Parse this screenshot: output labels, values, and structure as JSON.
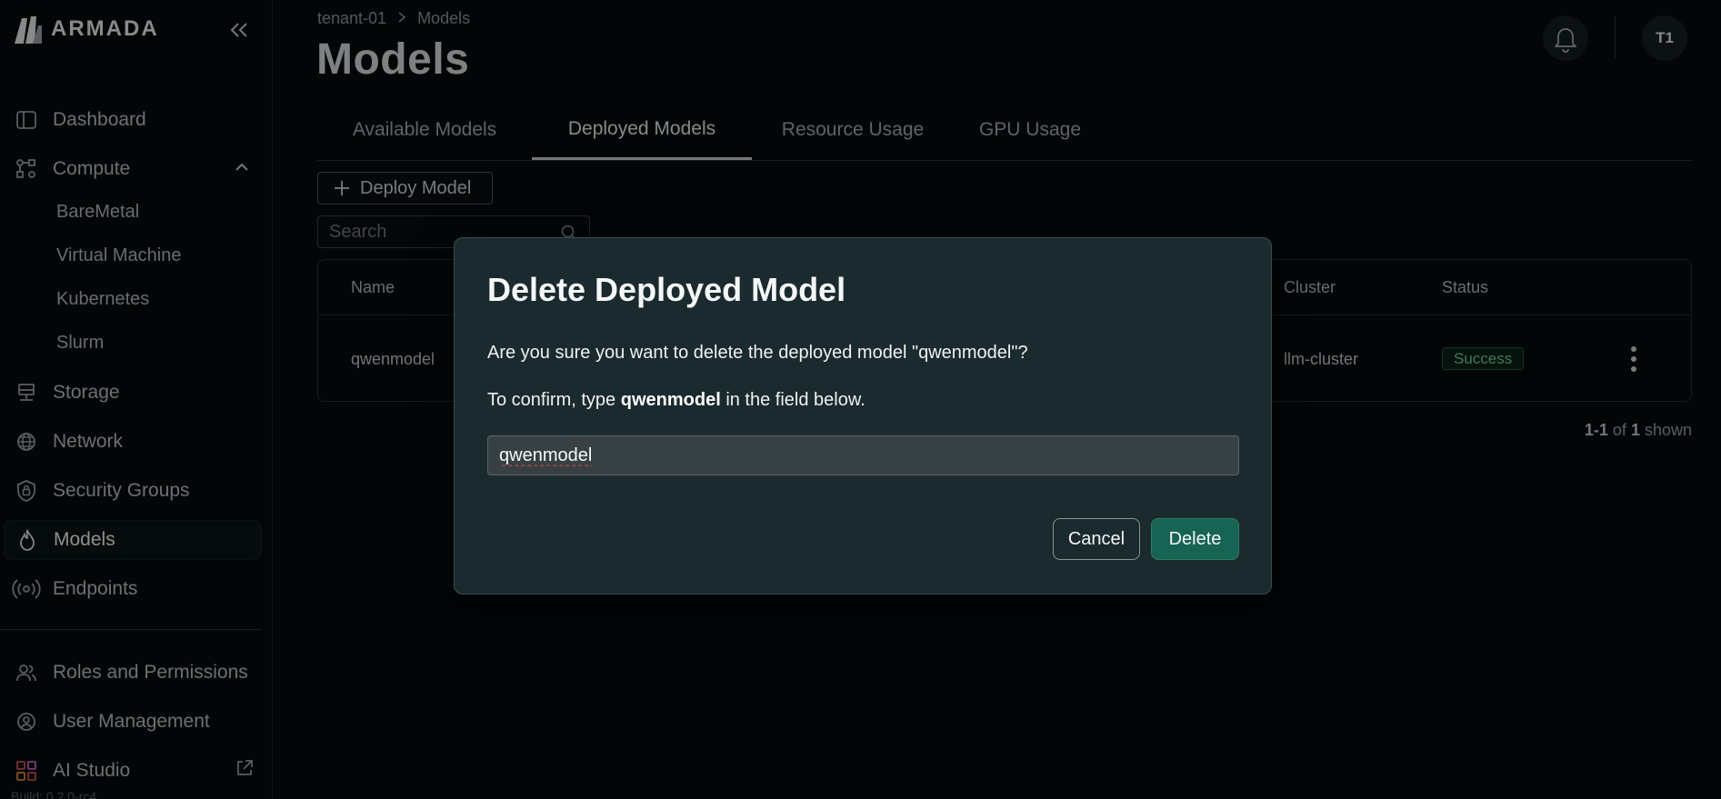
{
  "brand": {
    "name": "ARMADA"
  },
  "sidebar": {
    "items": [
      {
        "label": "Dashboard",
        "icon": "dashboard-icon"
      },
      {
        "label": "Compute",
        "icon": "compute-icon"
      },
      {
        "label": "Storage",
        "icon": "storage-icon"
      },
      {
        "label": "Network",
        "icon": "network-icon"
      },
      {
        "label": "Security Groups",
        "icon": "shield-lock-icon"
      },
      {
        "label": "Models",
        "icon": "flame-icon",
        "active": true
      },
      {
        "label": "Endpoints",
        "icon": "broadcast-icon"
      }
    ],
    "compute_sub": [
      "BareMetal",
      "Virtual Machine",
      "Kubernetes",
      "Slurm"
    ],
    "admin_items": [
      {
        "label": "Roles and Permissions",
        "icon": "users-icon"
      },
      {
        "label": "User Management",
        "icon": "user-settings-icon"
      },
      {
        "label": "AI Studio",
        "icon": "apps-grid-icon"
      }
    ],
    "build": "Build: 0.2.0-rc4"
  },
  "header": {
    "breadcrumb": [
      "tenant-01",
      "Models"
    ],
    "title": "Models",
    "avatar_initials": "T1"
  },
  "tabs": [
    {
      "label": "Available Models",
      "active": false
    },
    {
      "label": "Deployed Models",
      "active": true
    },
    {
      "label": "Resource Usage",
      "active": false
    },
    {
      "label": "GPU Usage",
      "active": false
    }
  ],
  "toolbar": {
    "deploy_label": "Deploy Model",
    "search_placeholder": "Search"
  },
  "table": {
    "columns": [
      "Name",
      "Cluster",
      "Status"
    ],
    "rows": [
      {
        "name": "qwenmodel",
        "cluster": "llm-cluster",
        "status": "Success"
      }
    ],
    "pager": {
      "range": "1-1",
      "of": "of",
      "total": "1",
      "suffix": "shown"
    }
  },
  "modal": {
    "title": "Delete Deployed Model",
    "question": "Are you sure you want to delete the deployed model \"qwenmodel\"?",
    "confirm_prefix": "To confirm, type",
    "confirm_name": "qwenmodel",
    "confirm_suffix": "in the field below.",
    "input_value": "qwenmodel",
    "cancel_label": "Cancel",
    "delete_label": "Delete"
  },
  "colors": {
    "background": "#040b0d",
    "modal_bg": "#1b2a2e",
    "delete_button": "#176354",
    "success_text": "#6fd09a"
  }
}
